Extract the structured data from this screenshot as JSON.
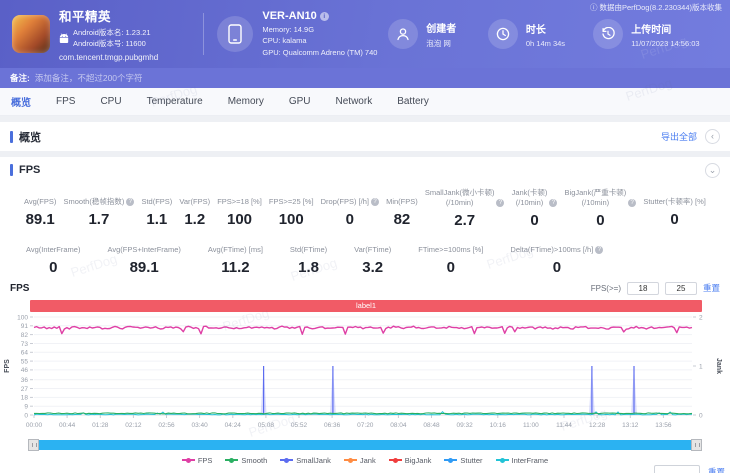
{
  "header": {
    "collect_note": "数据由PerfDog(8.2.230344)版本收集",
    "app": {
      "name": "和平精英",
      "version_name": "Android版本名: 1.23.21",
      "version_code": "Android版本号: 11600",
      "package": "com.tencent.tmgp.pubgmhd"
    },
    "device": {
      "model": "VER-AN10",
      "memory": "Memory: 14.9G",
      "cpu": "CPU: kalama",
      "gpu": "GPU: Qualcomm Adreno (TM) 740"
    },
    "creator": {
      "label": "创建者",
      "value": "泡泡 网"
    },
    "duration": {
      "label": "时长",
      "value": "0h 14m 34s"
    },
    "upload": {
      "label": "上传时间",
      "value": "11/07/2023 14:56:03"
    }
  },
  "remark": {
    "label": "备注:",
    "placeholder": "添加备注，不超过200个字符"
  },
  "tabs": [
    "概览",
    "FPS",
    "CPU",
    "Temperature",
    "Memory",
    "GPU",
    "Network",
    "Battery"
  ],
  "overview": {
    "title": "概览",
    "export_all": "导出全部",
    "collapse_glyph": "‹"
  },
  "fps_section": {
    "title": "FPS",
    "collapse_glyph": "⌄",
    "chart_title": "FPS",
    "threshold": {
      "label": "FPS(>=)",
      "input1": "18",
      "input2": "25",
      "reset": "重置"
    },
    "banner": "label1",
    "stats_row1": [
      {
        "label": "Avg(FPS)",
        "value": "89.1"
      },
      {
        "label": "Smooth(稳帧指数)",
        "value": "1.7",
        "info": true
      },
      {
        "label": "Std(FPS)",
        "value": "1.1"
      },
      {
        "label": "Var(FPS)",
        "value": "1.2"
      },
      {
        "label": "FPS>=18 [%]",
        "value": "100"
      },
      {
        "label": "FPS>=25 [%]",
        "value": "100"
      },
      {
        "label": "Drop(FPS) [/h]",
        "value": "0",
        "info": true
      },
      {
        "label": "Min(FPS)",
        "value": "82"
      },
      {
        "label": "SmallJank(微小卡顿)\n(/10min)",
        "value": "2.7",
        "info": true
      },
      {
        "label": "Jank(卡顿)\n(/10min)",
        "value": "0",
        "info": true
      },
      {
        "label": "BigJank(严重卡顿)\n(/10min)",
        "value": "0",
        "info": true
      },
      {
        "label": "Stutter(卡顿率) [%]",
        "value": "0"
      }
    ],
    "stats_row2": [
      {
        "label": "Avg(InterFrame)",
        "value": "0"
      },
      {
        "label": "Avg(FPS+InterFrame)",
        "value": "89.1"
      },
      {
        "label": "Avg(FTime) [ms]",
        "value": "11.2"
      },
      {
        "label": "Std(FTime)",
        "value": "1.8"
      },
      {
        "label": "Var(FTime)",
        "value": "3.2"
      },
      {
        "label": "FTime>=100ms [%]",
        "value": "0"
      },
      {
        "label": "Delta(FTime)>100ms [/h]",
        "value": "0",
        "info": true
      }
    ]
  },
  "chart_data": {
    "type": "line",
    "title": "FPS",
    "ylabel_left": "FPS",
    "ylabel_right": "Jank",
    "grid": true,
    "duration_seconds": 874,
    "ylim_left": [
      0,
      100
    ],
    "ylim_right": [
      0,
      2
    ],
    "y_ticks_left": [
      100,
      91,
      82,
      73,
      64,
      55,
      46,
      36,
      27,
      18,
      9,
      0
    ],
    "y_ticks_right": [
      2,
      1,
      0
    ],
    "x_ticks": [
      "00:00",
      "00:44",
      "01:28",
      "02:12",
      "02:56",
      "03:40",
      "04:24",
      "05:08",
      "05:52",
      "06:36",
      "07:20",
      "08:04",
      "08:48",
      "09:32",
      "10:16",
      "11:00",
      "11:44",
      "12:28",
      "13:12",
      "13:56"
    ],
    "series": [
      {
        "name": "FPS",
        "color": "#df3fa5",
        "avg": 89.1,
        "min": 82,
        "noise_amplitude": 1.1,
        "dip_probability": 0.035
      },
      {
        "name": "Smooth",
        "color": "#2aaf62",
        "avg": 1.7,
        "noise_amplitude": 0.5
      },
      {
        "name": "InterFrame",
        "color": "#22c3d6",
        "avg": 0.5,
        "noise_amplitude": 0.4
      },
      {
        "name": "SmallJank",
        "color": "#5c6cf0",
        "events": [
          {
            "time": "05:05",
            "jank": 1
          },
          {
            "time": "06:37",
            "jank": 1
          },
          {
            "time": "12:21",
            "jank": 1
          },
          {
            "time": "13:17",
            "jank": 1
          }
        ]
      },
      {
        "name": "Jank",
        "color": "#ff8c42",
        "avg": 0
      },
      {
        "name": "BigJank",
        "color": "#f03e3e",
        "avg": 0
      },
      {
        "name": "Stutter",
        "color": "#2f9bf5",
        "avg": 0
      }
    ],
    "legend_position": "bottom"
  },
  "legend": [
    {
      "name": "FPS",
      "color": "#df3fa5"
    },
    {
      "name": "Smooth",
      "color": "#2aaf62"
    },
    {
      "name": "SmallJank",
      "color": "#5c6cf0"
    },
    {
      "name": "Jank",
      "color": "#ff8c42"
    },
    {
      "name": "BigJank",
      "color": "#f03e3e"
    },
    {
      "name": "Stutter",
      "color": "#2f9bf5"
    },
    {
      "name": "InterFrame",
      "color": "#22c3d6"
    }
  ],
  "partial_next": {
    "reset": "重置"
  },
  "watermark": "PerfDog"
}
